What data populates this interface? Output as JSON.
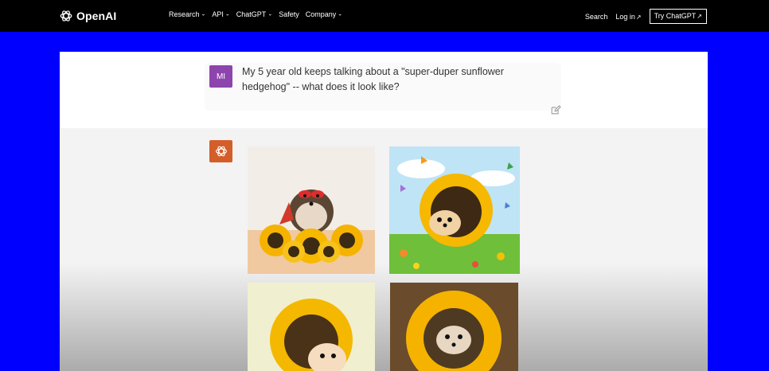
{
  "nav": {
    "brand": "OpenAI",
    "links": [
      {
        "label": "Research",
        "has_chevron": true
      },
      {
        "label": "API",
        "has_chevron": true
      },
      {
        "label": "ChatGPT",
        "has_chevron": true
      },
      {
        "label": "Safety",
        "has_chevron": false
      },
      {
        "label": "Company",
        "has_chevron": true
      }
    ],
    "search_label": "Search",
    "login_label": "Log in",
    "login_arrow": "↗",
    "try_label": "Try ChatGPT",
    "try_arrow": "↗",
    "chevron_glyph": "⌄"
  },
  "conversation": {
    "user_initials": "MI",
    "user_message": "My 5 year old keeps talking about a \"super-duper sunflower hedgehog\" -- what does it look like?",
    "assistant_images": [
      {
        "name": "hedgehog-superhero-mask-sunflowers",
        "icon": "image"
      },
      {
        "name": "cartoon-hedgehog-sunflower-butterflies",
        "icon": "image"
      },
      {
        "name": "cartoon-hedgehog-sunflower-head",
        "icon": "image"
      },
      {
        "name": "hedgehog-in-sunflower",
        "icon": "image"
      }
    ]
  },
  "colors": {
    "page_bg": "#0000fe",
    "nav_bg": "#000000",
    "user_avatar": "#8e44ad",
    "assistant_avatar": "#d35e2a"
  }
}
